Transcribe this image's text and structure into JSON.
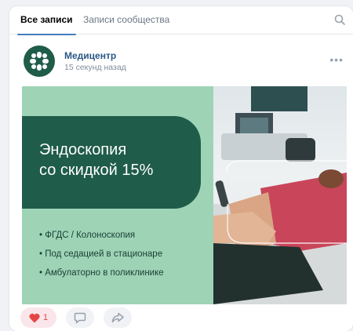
{
  "tabs": [
    {
      "label": "Все записи",
      "active": true
    },
    {
      "label": "Записи сообщества",
      "active": false
    }
  ],
  "post": {
    "author": "Медицентр",
    "time": "15 секунд назад",
    "image": {
      "title_line1": "Эндоскопия",
      "title_line2": "со скидкой 15%",
      "bullets": [
        "• ФГДС / Колоноскопия",
        "• Под седацией в стационаре",
        "• Амбулаторно в поликлинике"
      ]
    },
    "actions": {
      "likes": "1"
    }
  },
  "colors": {
    "brand_dark_green": "#1f5c49",
    "brand_light_green": "#9fd3b6",
    "like_red": "#e64646",
    "link_blue": "#2a5885"
  },
  "icons": [
    "search-icon",
    "more-icon",
    "heart-icon",
    "comment-icon",
    "share-icon",
    "logo-icon"
  ]
}
